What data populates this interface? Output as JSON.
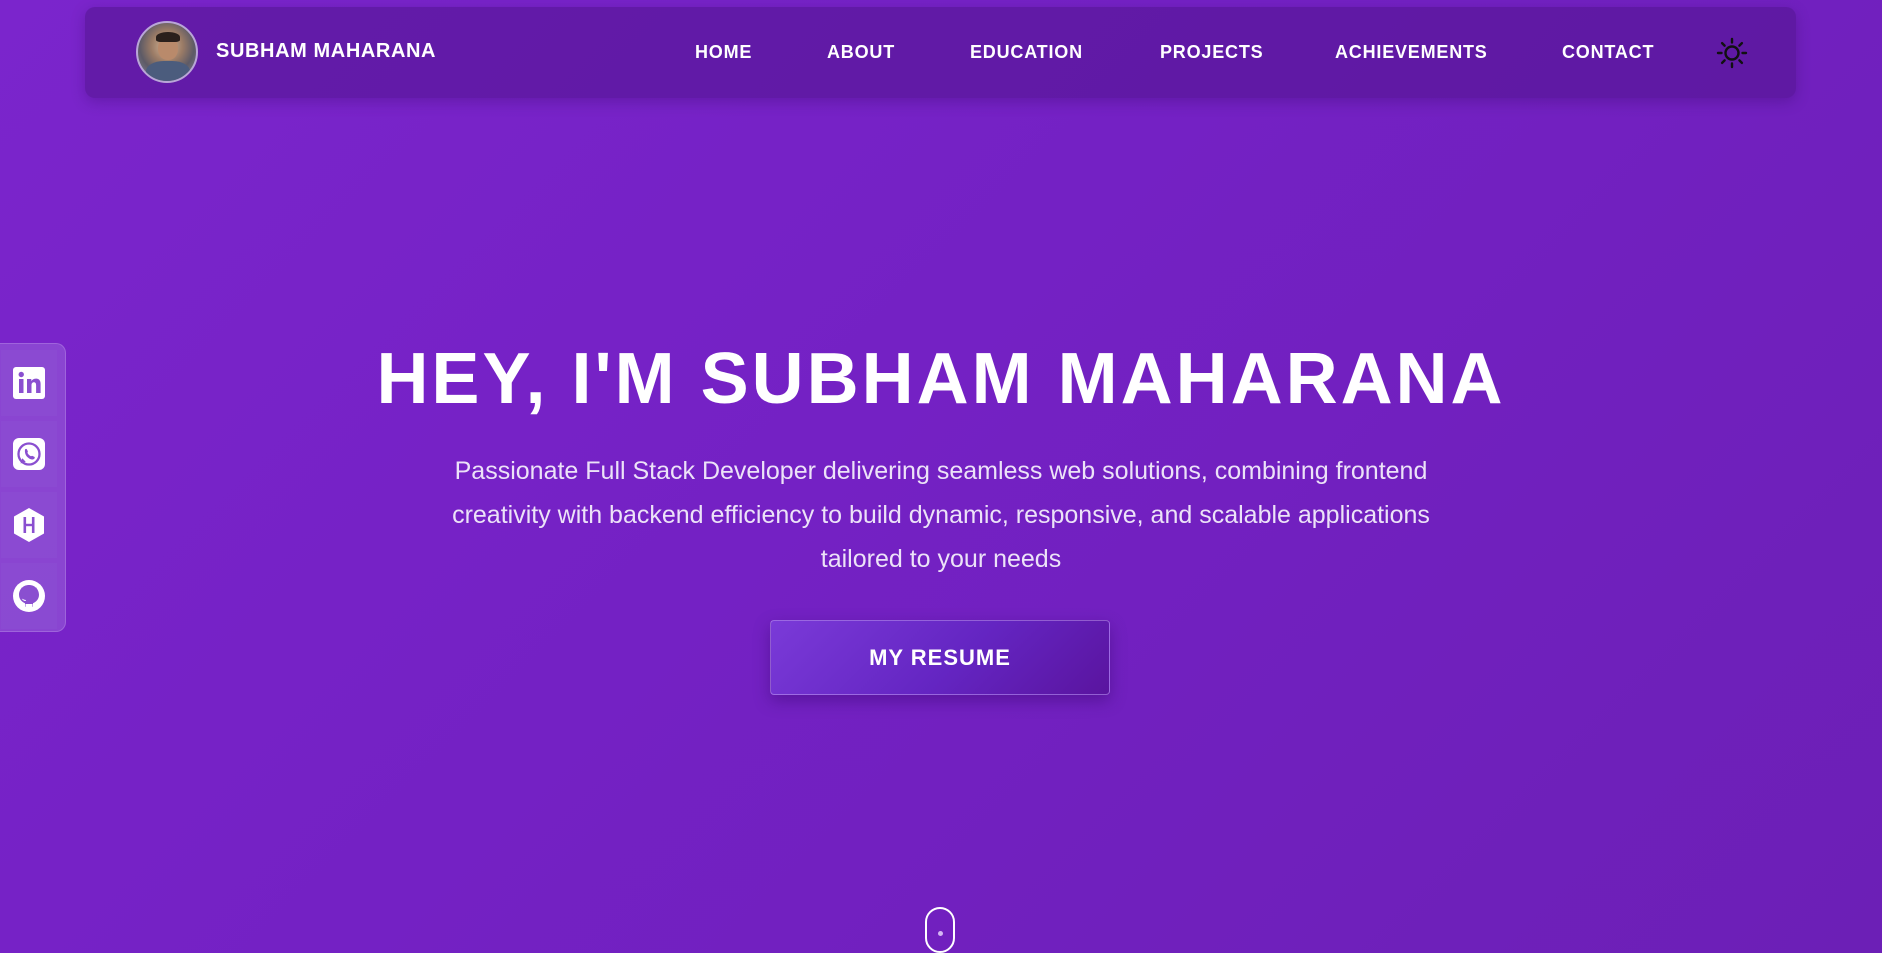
{
  "brand": {
    "name": "SUBHAM MAHARANA"
  },
  "nav": {
    "links": [
      "HOME",
      "ABOUT",
      "EDUCATION",
      "PROJECTS",
      "ACHIEVEMENTS",
      "CONTACT"
    ]
  },
  "hero": {
    "title": "HEY, I'M SUBHAM MAHARANA",
    "description": "Passionate Full Stack Developer delivering seamless web solutions, combining frontend creativity with backend efficiency to build dynamic, responsive, and scalable applications tailored to your needs",
    "button_label": "MY RESUME"
  },
  "social": {
    "icons": [
      "linkedin-icon",
      "whatsapp-icon",
      "hashnode-icon",
      "github-icon"
    ]
  },
  "icons": {
    "theme": "sun-icon",
    "scroll": "mouse-scroll-icon"
  },
  "colors": {
    "background": "#7421c4",
    "navbar": "#56178f",
    "button": "#6425c2",
    "text": "#ffffff"
  }
}
